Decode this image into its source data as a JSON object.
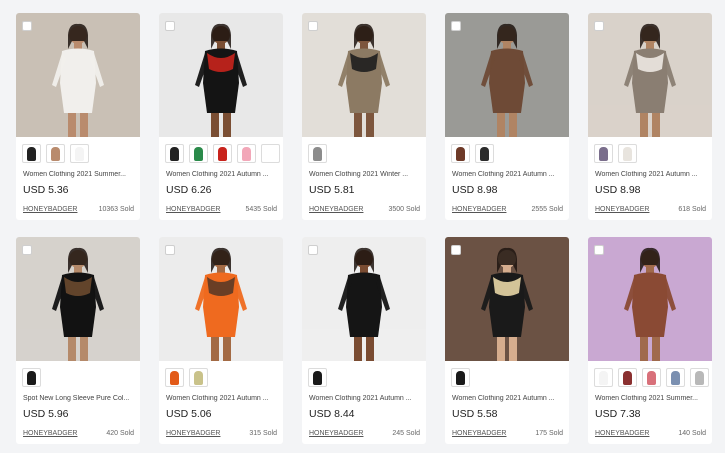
{
  "products": [
    {
      "title": "Women Clothing 2021 Summer...",
      "price": "USD 5.36",
      "seller": "HONEYBADGER",
      "sold": "10363 Sold",
      "photo": {
        "bg": "#c9c0b5",
        "fig": "#f1efec",
        "skin": "#b98b6d"
      },
      "swatches": [
        "#222222",
        "#b98b6d",
        "#f4f4f4"
      ],
      "more": false
    },
    {
      "title": "Women Clothing 2021 Autumn ...",
      "price": "USD 6.26",
      "seller": "HONEYBADGER",
      "sold": "5435 Sold",
      "photo": {
        "bg": "#e8e8e8",
        "fig": "#141414",
        "skin": "#7a4e33",
        "accent": "#c8231c"
      },
      "swatches": [
        "#222222",
        "#2a8a4a",
        "#c8231c",
        "#f2a7b8",
        "#ffffff"
      ],
      "more": true
    },
    {
      "title": "Women Clothing 2021 Winter ...",
      "price": "USD 5.81",
      "seller": "HONEYBADGER",
      "sold": "3500 Sold",
      "photo": {
        "bg": "#e2ded8",
        "fig": "#8c7a63",
        "skin": "#7d563d",
        "accent": "#1e1e1e"
      },
      "swatches": [
        "#8c8c8c"
      ],
      "more": false
    },
    {
      "title": "Women Clothing 2021 Autumn ...",
      "price": "USD 8.98",
      "seller": "HONEYBADGER",
      "sold": "2555 Sold",
      "photo": {
        "bg": "#9a9a96",
        "fig": "#6e4a36",
        "skin": "#b08463"
      },
      "swatches": [
        "#6e3a28",
        "#2b2b2b"
      ],
      "more": false
    },
    {
      "title": "Women Clothing 2021 Autumn ...",
      "price": "USD 8.98",
      "seller": "HONEYBADGER",
      "sold": "618 Sold",
      "photo": {
        "bg": "#d9d2ca",
        "fig": "#8a7e72",
        "skin": "#b08463",
        "accent": "#ece8e2"
      },
      "swatches": [
        "#7a6e8c",
        "#e8e4de"
      ],
      "more": false
    },
    {
      "title": "Spot New Long Sleeve Pure Col...",
      "price": "USD 5.96",
      "seller": "HONEYBADGER",
      "sold": "420 Sold",
      "photo": {
        "bg": "#d6d2cc",
        "fig": "#121212",
        "skin": "#b58a6a",
        "accent": "#6b4a2f"
      },
      "swatches": [
        "#1a1a1a"
      ],
      "more": false
    },
    {
      "title": "Women Clothing 2021 Autumn ...",
      "price": "USD 5.06",
      "seller": "HONEYBADGER",
      "sold": "315 Sold",
      "photo": {
        "bg": "#ececec",
        "fig": "#ef6a1f",
        "skin": "#a36a44",
        "accent": "#5b3a26"
      },
      "swatches": [
        "#e25a18",
        "#c9c28a"
      ],
      "more": false
    },
    {
      "title": "Women Clothing 2021 Autumn ...",
      "price": "USD 8.44",
      "seller": "HONEYBADGER",
      "sold": "245 Sold",
      "photo": {
        "bg": "#eeeeee",
        "fig": "#151515",
        "skin": "#7a4c32"
      },
      "swatches": [
        "#1a1a1a"
      ],
      "more": false
    },
    {
      "title": "Women Clothing 2021 Autumn ...",
      "price": "USD 5.58",
      "seller": "HONEYBADGER",
      "sold": "175 Sold",
      "photo": {
        "bg": "#6b5244",
        "fig": "#1a1a1a",
        "skin": "#d6ad8e",
        "accent": "#e8d6a6"
      },
      "swatches": [
        "#1a1a1a"
      ],
      "more": false
    },
    {
      "title": "Women Clothing 2021 Summer...",
      "price": "USD 7.38",
      "seller": "HONEYBADGER",
      "sold": "140 Sold",
      "photo": {
        "bg": "#c9a8d2",
        "fig": "#8a4a34",
        "skin": "#a06a4c"
      },
      "swatches": [
        "#f4f4f4",
        "#8a3030",
        "#d8707a",
        "#7a8fb0",
        "#b8b8b8"
      ],
      "more": false
    }
  ]
}
